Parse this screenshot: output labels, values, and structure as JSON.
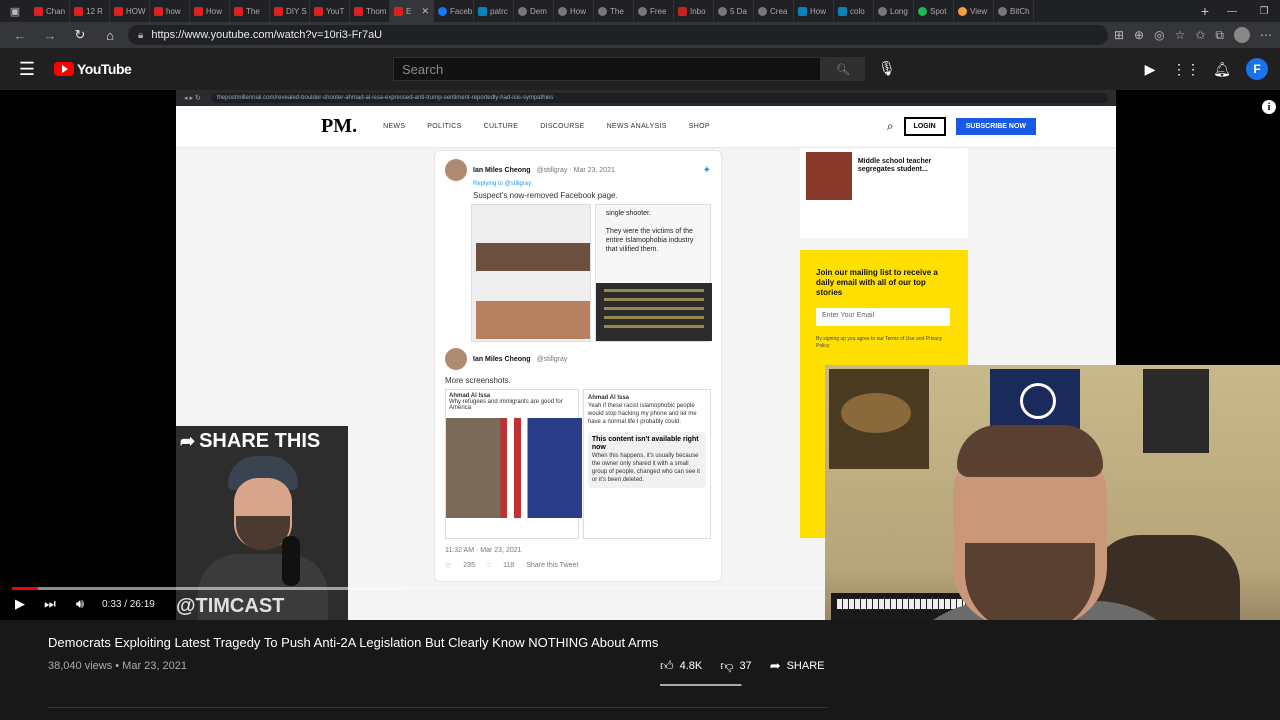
{
  "browser": {
    "tabs": [
      {
        "label": "Chan",
        "fav": "yt"
      },
      {
        "label": "12 R",
        "fav": "yt"
      },
      {
        "label": "HOW",
        "fav": "yt"
      },
      {
        "label": "how",
        "fav": "yt"
      },
      {
        "label": "How",
        "fav": "yt"
      },
      {
        "label": "The",
        "fav": "yt"
      },
      {
        "label": "DIY S",
        "fav": "yt"
      },
      {
        "label": "YouT",
        "fav": "yt"
      },
      {
        "label": "Thom",
        "fav": "yt"
      },
      {
        "label": "E",
        "fav": "yt",
        "active": true
      },
      {
        "label": "Faceb",
        "fav": "fb"
      },
      {
        "label": "patrc",
        "fav": "bing"
      },
      {
        "label": "Dem",
        "fav": "gen"
      },
      {
        "label": "How",
        "fav": "gen"
      },
      {
        "label": "The",
        "fav": "gen"
      },
      {
        "label": "Free",
        "fav": "gen"
      },
      {
        "label": "Inbo",
        "fav": "gm"
      },
      {
        "label": "5 Da",
        "fav": "gen"
      },
      {
        "label": "Crea",
        "fav": "gen"
      },
      {
        "label": "How",
        "fav": "bing"
      },
      {
        "label": "colo",
        "fav": "bing"
      },
      {
        "label": "Long",
        "fav": "gen"
      },
      {
        "label": "Spot",
        "fav": "sp"
      },
      {
        "label": "View",
        "fav": "or"
      },
      {
        "label": "BitCh",
        "fav": "gen"
      }
    ],
    "url": "https://www.youtube.com/watch?v=10ri3-Fr7aU"
  },
  "header": {
    "logo_text": "YouTube",
    "search_placeholder": "Search",
    "avatar_letter": "F"
  },
  "video_content": {
    "inner_url": "thepostmillennial.com/revealed-boulder-shooter-ahmad-al-issa-expressed-anti-trump-sentiment-reportedly-had-isis-sympathies",
    "site_logo": "PM.",
    "nav": [
      "NEWS",
      "POLITICS",
      "CULTURE",
      "DISCOURSE",
      "NEWS ANALYSIS",
      "SHOP"
    ],
    "login": "LOGIN",
    "subscribe": "SUBSCRIBE NOW",
    "tweet1": {
      "name": "Ian Miles Cheong",
      "handle": "@stillgray · Mar 23, 2021",
      "replying": "Replying to @stillgray",
      "text": "Suspect's now-removed Facebook page."
    },
    "shot_text": "single shooter.\n\nThey were the victims of the entire Islamophobia industry that vilified them.",
    "tweet2": {
      "name": "Ian Miles Cheong",
      "handle": "@stillgray",
      "text": "More screenshots."
    },
    "card_left_name": "Ahmad Al Issa",
    "card_left_text": "Why refugees and immigrants are good for America",
    "card_right_name": "Ahmad Al Issa",
    "card_right_text": "Yeah if these racist islamophobic people would stop hacking my phone and let me have a normal life I probably could.",
    "unavailable_title": "This content isn't available right now",
    "unavailable_text": "When this happens, it's usually because the owner only shared it with a small group of people, changed who can see it or it's been deleted.",
    "tweet_time": "11:32 AM · Mar 23, 2021",
    "tweet_stats": [
      "235",
      "118",
      "Share this Tweet"
    ],
    "side_story": "Middle school teacher segregates student...",
    "mailing_title": "Join our mailing list to receive a daily email with all of our top stories",
    "mailing_input": "Enter Your Email",
    "mailing_fine": "By signing up you agree to our Terms of Use and Privacy Policy",
    "share_title": "SHARE THIS",
    "share_handle": "@TIMCAST"
  },
  "player": {
    "time": "0:33 / 26:19",
    "progress": 0.021,
    "buffered": 0.31
  },
  "video": {
    "title": "Democrats Exploiting Latest Tragedy To Push Anti-2A Legislation But Clearly Know NOTHING About Arms",
    "meta": "38,040 views • Mar 23, 2021",
    "likes": "4.8K",
    "dislikes": "37",
    "share": "SHARE",
    "like_ratio": 0.99
  }
}
